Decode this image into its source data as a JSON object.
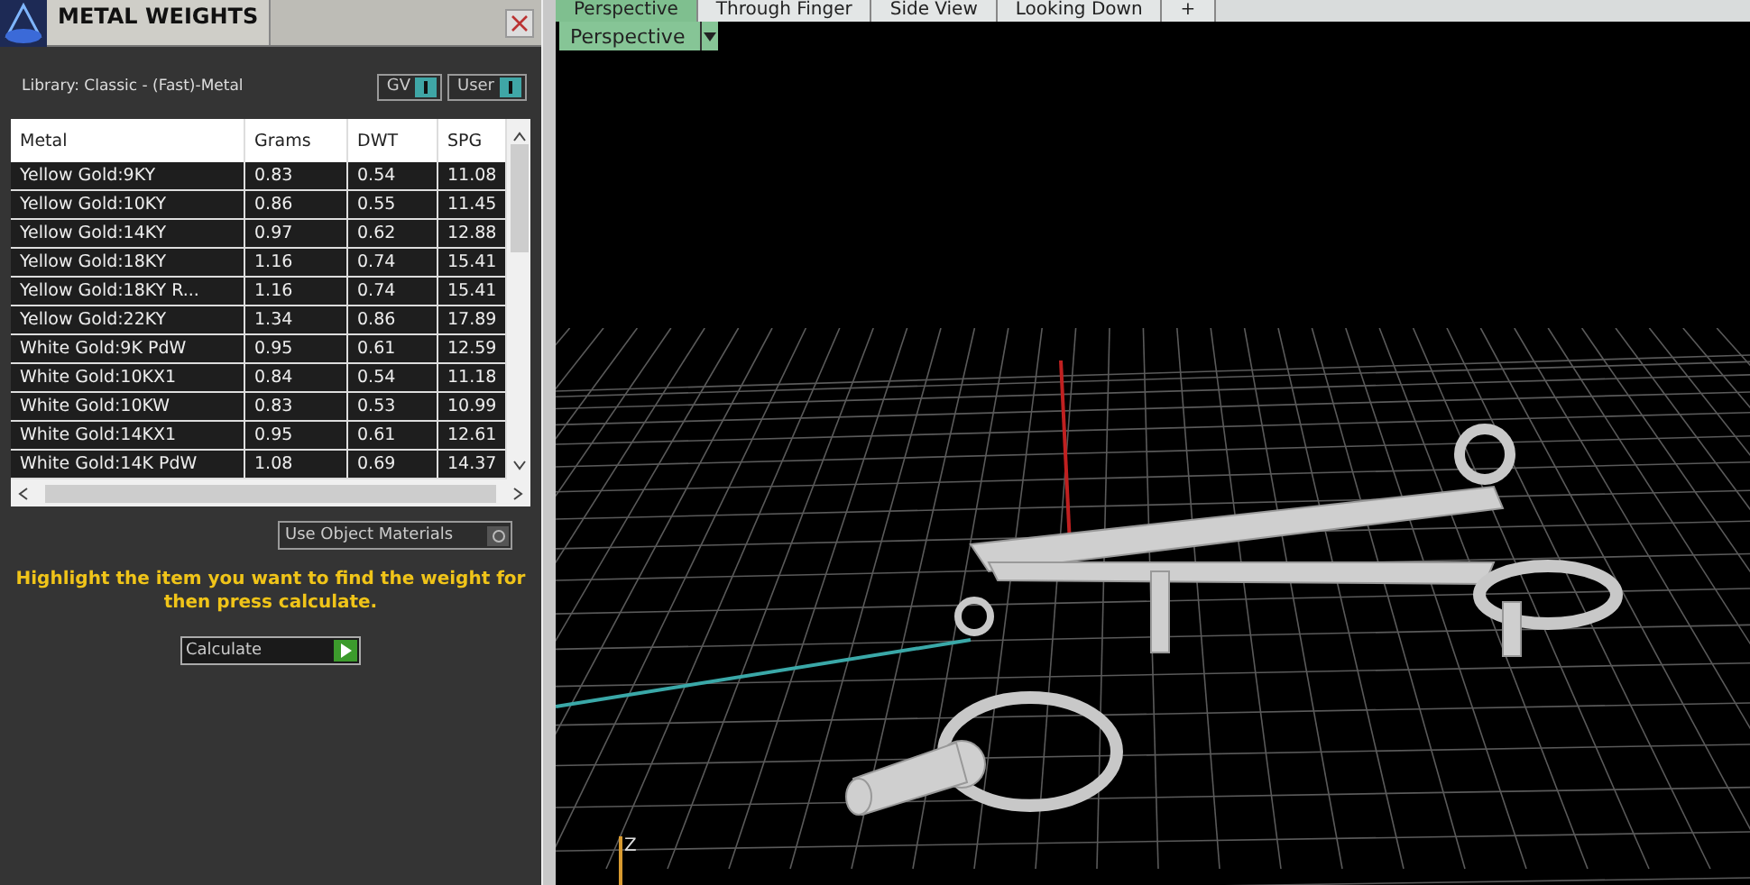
{
  "panel": {
    "title": "METAL WEIGHTS",
    "library": "Library: Classic - (Fast)-Metal",
    "toggles": [
      {
        "label": "GV",
        "on": true
      },
      {
        "label": "User",
        "on": true
      }
    ]
  },
  "table": {
    "columns": [
      "Metal",
      "Grams",
      "DWT",
      "SPG"
    ],
    "rows": [
      [
        "Yellow Gold:9KY",
        "0.83",
        "0.54",
        "11.08"
      ],
      [
        "Yellow Gold:10KY",
        "0.86",
        "0.55",
        "11.45"
      ],
      [
        "Yellow Gold:14KY",
        "0.97",
        "0.62",
        "12.88"
      ],
      [
        "Yellow Gold:18KY",
        "1.16",
        "0.74",
        "15.41"
      ],
      [
        "Yellow Gold:18KY R...",
        "1.16",
        "0.74",
        "15.41"
      ],
      [
        "Yellow Gold:22KY",
        "1.34",
        "0.86",
        "17.89"
      ],
      [
        "White Gold:9K PdW",
        "0.95",
        "0.61",
        "12.59"
      ],
      [
        "White Gold:10KX1",
        "0.84",
        "0.54",
        "11.18"
      ],
      [
        "White Gold:10KW",
        "0.83",
        "0.53",
        "10.99"
      ],
      [
        "White Gold:14KX1",
        "0.95",
        "0.61",
        "12.61"
      ],
      [
        "White Gold:14K PdW",
        "1.08",
        "0.69",
        "14.37"
      ]
    ]
  },
  "object_materials": {
    "label": "Use Object Materials",
    "on": false
  },
  "hint": "Highlight the item you want to find the weight for then press calculate.",
  "calculate": "Calculate",
  "view_tabs": [
    {
      "label": "Perspective",
      "selected": true
    },
    {
      "label": "Through Finger",
      "selected": false
    },
    {
      "label": "Side View",
      "selected": false
    },
    {
      "label": "Looking Down",
      "selected": false
    },
    {
      "label": "+",
      "selected": false
    }
  ],
  "view_menu": "Perspective",
  "axis_label": "Z"
}
